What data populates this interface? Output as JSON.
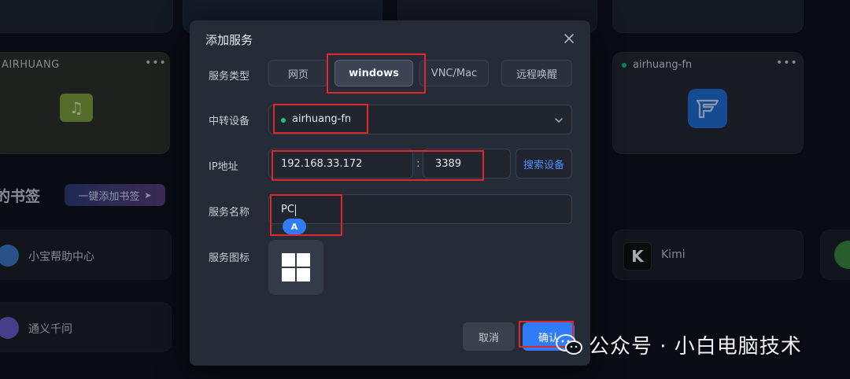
{
  "background": {
    "airhuang_card_title": "AIRHUANG",
    "fn_card_title": "airhuang-fn",
    "bookmarks_title": "我的书签",
    "bookmarks_title_visible": "的书签",
    "add_bookmark_button": "一键添加书签",
    "bookmarks": [
      {
        "label": "小宝帮助中心"
      },
      {
        "label": "通义千问"
      },
      {
        "label": "Kimi"
      }
    ],
    "kimi_icon_letter": "K"
  },
  "dialog": {
    "title": "添加服务",
    "service_type": {
      "label": "服务类型",
      "options": [
        "网页",
        "windows",
        "VNC/Mac",
        "远程唤醒"
      ],
      "selected": "windows"
    },
    "relay_device": {
      "label": "中转设备",
      "value": "airhuang-fn",
      "status_color": "#22c17a"
    },
    "ip_address": {
      "label": "IP地址",
      "ip": "192.168.33.172",
      "separator": ":",
      "port": "3389",
      "search_button": "搜索设备"
    },
    "service_name": {
      "label": "服务名称",
      "value": "PC",
      "ime_indicator": "A"
    },
    "service_icon": {
      "label": "服务图标",
      "icon": "windows-logo-icon"
    },
    "buttons": {
      "cancel": "取消",
      "confirm": "确认"
    }
  },
  "watermark": {
    "text": "公众号 · 小白电脑技术"
  },
  "colors": {
    "accent": "#2f7cf6",
    "highlight": "#e0252b",
    "online": "#22c17a",
    "dialog_bg": "#252b37"
  }
}
